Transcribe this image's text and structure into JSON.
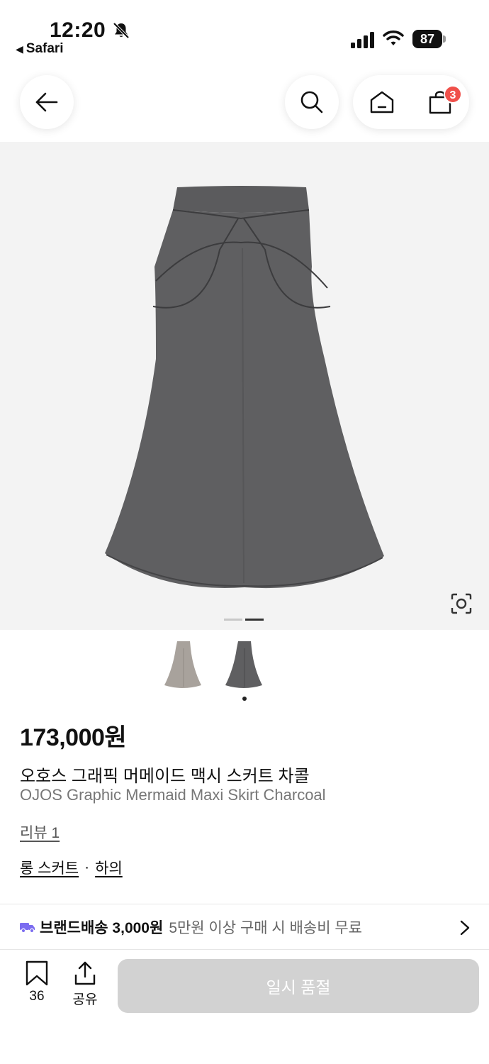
{
  "status_bar": {
    "time": "12:20",
    "back_app": "Safari",
    "battery": "87",
    "icons": [
      "bell-slash-icon",
      "signal-icon",
      "wifi-icon",
      "battery-icon"
    ]
  },
  "header": {
    "cart_count": "3",
    "icons": [
      "arrow-left-icon",
      "search-icon",
      "home-icon",
      "shopping-bag-icon"
    ]
  },
  "gallery": {
    "image_count": 2,
    "active_index": 1
  },
  "product": {
    "price": "173,000원",
    "title_ko": "오호스 그래픽 머메이드 맥시 스커트 차콜",
    "title_en": "OJOS Graphic Mermaid Maxi Skirt Charcoal",
    "review": "리뷰 1",
    "category_main": "롱 스커트",
    "category_separator": "·",
    "category_sub": "하의"
  },
  "shipping": {
    "label": "브랜드배송 3,000원",
    "note": "5만원 이상 구매 시 배송비 무료"
  },
  "bottom_bar": {
    "bookmark_count": "36",
    "share_label": "공유",
    "soldout_label": "일시 품절"
  },
  "colors": {
    "badge": "#f0504a",
    "soldout_button": "#d2d2d2",
    "skirt": "#5f5f61",
    "truck": "#7b6cf0"
  }
}
